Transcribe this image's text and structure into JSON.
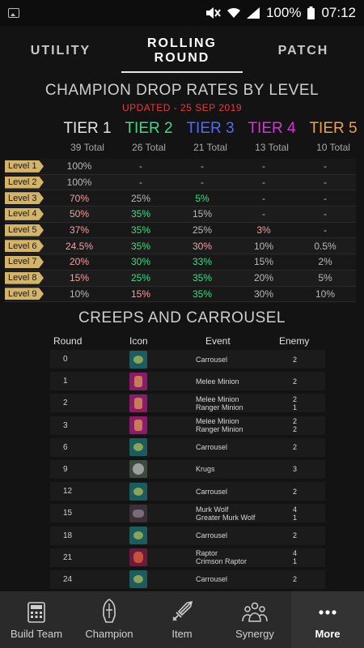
{
  "status": {
    "battery": "100%",
    "time": "07:12"
  },
  "tabs": [
    {
      "label": "UTILITY",
      "active": false
    },
    {
      "label": "ROLLING ROUND",
      "active": true
    },
    {
      "label": "PATCH",
      "active": false
    }
  ],
  "drop_rates": {
    "title": "CHAMPION DROP RATES BY LEVEL",
    "updated": "UPDATED - 25 SEP 2019",
    "tiers": [
      {
        "name": "TIER 1",
        "total": "39 Total",
        "color": "#e6e6e6"
      },
      {
        "name": "TIER 2",
        "total": "26 Total",
        "color": "#3ddc84"
      },
      {
        "name": "TIER 3",
        "total": "21 Total",
        "color": "#4d6bff"
      },
      {
        "name": "TIER 4",
        "total": "13 Total",
        "color": "#d633d6"
      },
      {
        "name": "TIER 5",
        "total": "10 Total",
        "color": "#f0a050"
      }
    ],
    "rows": [
      {
        "level": "Level 1",
        "values": [
          "100%",
          "-",
          "-",
          "-",
          "-"
        ],
        "colors": [
          "#b9b9b9",
          "#b9b9b9",
          "#b9b9b9",
          "#b9b9b9",
          "#b9b9b9"
        ]
      },
      {
        "level": "Level 2",
        "values": [
          "100%",
          "-",
          "-",
          "-",
          "-"
        ],
        "colors": [
          "#b9b9b9",
          "#b9b9b9",
          "#b9b9b9",
          "#b9b9b9",
          "#b9b9b9"
        ]
      },
      {
        "level": "Level 3",
        "values": [
          "70%",
          "25%",
          "5%",
          "-",
          "-"
        ],
        "colors": [
          "#f2a0a0",
          "#b9b9b9",
          "#3ddc84",
          "#b9b9b9",
          "#b9b9b9"
        ]
      },
      {
        "level": "Level 4",
        "values": [
          "50%",
          "35%",
          "15%",
          "-",
          "-"
        ],
        "colors": [
          "#f2a0a0",
          "#3ddc84",
          "#b9b9b9",
          "#b9b9b9",
          "#b9b9b9"
        ]
      },
      {
        "level": "Level 5",
        "values": [
          "37%",
          "35%",
          "25%",
          "3%",
          "-"
        ],
        "colors": [
          "#f2a0a0",
          "#3ddc84",
          "#b9b9b9",
          "#f2a0a0",
          "#b9b9b9"
        ]
      },
      {
        "level": "Level 6",
        "values": [
          "24.5%",
          "35%",
          "30%",
          "10%",
          "0.5%"
        ],
        "colors": [
          "#f2a0a0",
          "#3ddc84",
          "#f2a0a0",
          "#b9b9b9",
          "#b9b9b9"
        ]
      },
      {
        "level": "Level 7",
        "values": [
          "20%",
          "30%",
          "33%",
          "15%",
          "2%"
        ],
        "colors": [
          "#f2a0a0",
          "#3ddc84",
          "#3ddc84",
          "#b9b9b9",
          "#b9b9b9"
        ]
      },
      {
        "level": "Level 8",
        "values": [
          "15%",
          "25%",
          "35%",
          "20%",
          "5%"
        ],
        "colors": [
          "#f2a0a0",
          "#3ddc84",
          "#3ddc84",
          "#b9b9b9",
          "#b9b9b9"
        ]
      },
      {
        "level": "Level 9",
        "values": [
          "10%",
          "15%",
          "35%",
          "30%",
          "10%"
        ],
        "colors": [
          "#b9b9b9",
          "#f2a0a0",
          "#3ddc84",
          "#b9b9b9",
          "#b9b9b9"
        ]
      }
    ]
  },
  "creeps": {
    "title": "CREEPS AND CARROUSEL",
    "headers": {
      "round": "Round",
      "icon": "Icon",
      "event": "Event",
      "enemy": "Enemy"
    },
    "rows": [
      {
        "round": "0",
        "icon": "carousel",
        "event": [
          "Carrousel"
        ],
        "enemy": [
          "2"
        ]
      },
      {
        "round": "1",
        "icon": "melee",
        "event": [
          "Melee Minion"
        ],
        "enemy": [
          "2"
        ]
      },
      {
        "round": "2",
        "icon": "melee",
        "event": [
          "Melee Minion",
          "Ranger Minion"
        ],
        "enemy": [
          "2",
          "1"
        ]
      },
      {
        "round": "3",
        "icon": "melee",
        "event": [
          "Melee Minion",
          "Ranger Minion"
        ],
        "enemy": [
          "2",
          "2"
        ]
      },
      {
        "round": "6",
        "icon": "carousel",
        "event": [
          "Carrousel"
        ],
        "enemy": [
          "2"
        ]
      },
      {
        "round": "9",
        "icon": "krugs",
        "event": [
          "Krugs"
        ],
        "enemy": [
          "3"
        ]
      },
      {
        "round": "12",
        "icon": "carousel",
        "event": [
          "Carrousel"
        ],
        "enemy": [
          "2"
        ]
      },
      {
        "round": "15",
        "icon": "wolf",
        "event": [
          "Murk Wolf",
          "Greater Murk Wolf"
        ],
        "enemy": [
          "4",
          "1"
        ]
      },
      {
        "round": "18",
        "icon": "carousel",
        "event": [
          "Carrousel"
        ],
        "enemy": [
          "2"
        ]
      },
      {
        "round": "21",
        "icon": "raptor",
        "event": [
          "Raptor",
          "Crimson Raptor"
        ],
        "enemy": [
          "4",
          "1"
        ]
      },
      {
        "round": "24",
        "icon": "carousel",
        "event": [
          "Carrousel"
        ],
        "enemy": [
          "2"
        ]
      }
    ]
  },
  "nav": [
    {
      "label": "Build Team",
      "icon": "calculator-icon",
      "active": false
    },
    {
      "label": "Champion",
      "icon": "helmet-icon",
      "active": false
    },
    {
      "label": "Item",
      "icon": "sword-icon",
      "active": false
    },
    {
      "label": "Synergy",
      "icon": "group-icon",
      "active": false
    },
    {
      "label": "More",
      "icon": "more-icon",
      "active": true
    }
  ]
}
